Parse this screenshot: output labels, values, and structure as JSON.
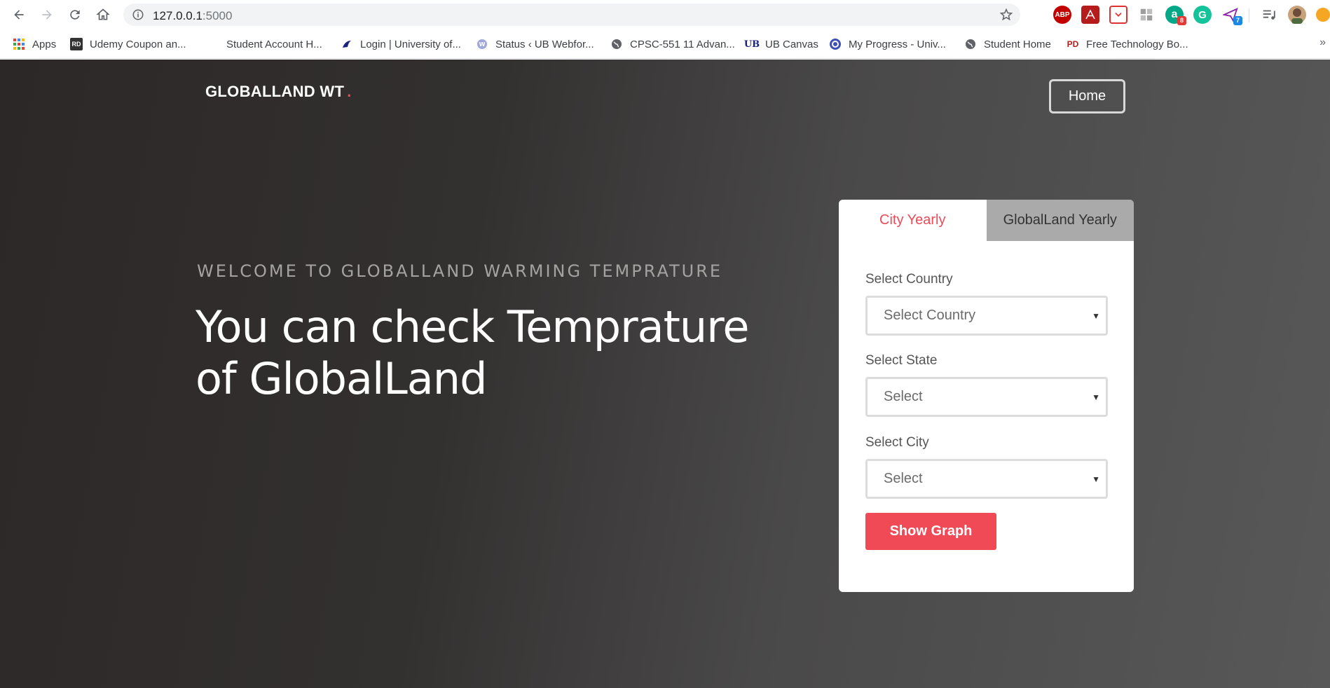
{
  "browser": {
    "url_host": "127.0.0.1",
    "url_port": ":5000",
    "extensions": [
      {
        "name": "abp",
        "label": "ABP",
        "color": "#c20000"
      },
      {
        "name": "pdf",
        "label": "",
        "color": "#b71c1c"
      },
      {
        "name": "pocket",
        "label": "",
        "color": "#ffffff"
      },
      {
        "name": "puzzle",
        "label": "",
        "color": "#9e9e9e"
      },
      {
        "name": "a-ext",
        "label": "a",
        "color": "#00a887",
        "badge": "8"
      },
      {
        "name": "grammarly",
        "label": "G",
        "color": "#15c39a"
      },
      {
        "name": "send",
        "label": "",
        "color": "#ffffff",
        "badge": "7"
      }
    ],
    "bookmarks": [
      {
        "label": "Apps",
        "icon": "apps-grid-icon"
      },
      {
        "label": "Udemy Coupon an...",
        "icon": "rd-icon"
      },
      {
        "label": "Student Account H...",
        "icon": "blank-icon"
      },
      {
        "label": "Login | University of...",
        "icon": "bird-icon"
      },
      {
        "label": "Status ‹ UB Webfor...",
        "icon": "wp-icon"
      },
      {
        "label": "CPSC-551 11 Advan...",
        "icon": "globe-icon"
      },
      {
        "label": "UB Canvas",
        "icon": "ub-icon"
      },
      {
        "label": "My Progress - Univ...",
        "icon": "progress-icon"
      },
      {
        "label": "Student Home",
        "icon": "globe-icon"
      },
      {
        "label": "Free Technology Bo...",
        "icon": "pd-icon"
      }
    ],
    "bookmarks_overflow": "»"
  },
  "nav": {
    "brand": "GLOBALLAND WT",
    "brand_dot": ".",
    "home_label": "Home"
  },
  "hero": {
    "welcome": "WELCOME TO GLOBALLAND WARMING TEMPRATURE",
    "headline_line1": "You can check Temprature",
    "headline_line2": "of GlobalLand"
  },
  "form": {
    "tabs": [
      {
        "label": "City Yearly",
        "active": true
      },
      {
        "label": "GlobalLand Yearly",
        "active": false
      }
    ],
    "country_label": "Select Country",
    "country_value": "Select Country",
    "state_label": "Select State",
    "state_value": "Select",
    "city_label": "Select City",
    "city_value": "Select",
    "caret": "▼",
    "submit_label": "Show Graph"
  },
  "colors": {
    "accent": "#f04a57",
    "tab_inactive": "#aaaaaa"
  }
}
